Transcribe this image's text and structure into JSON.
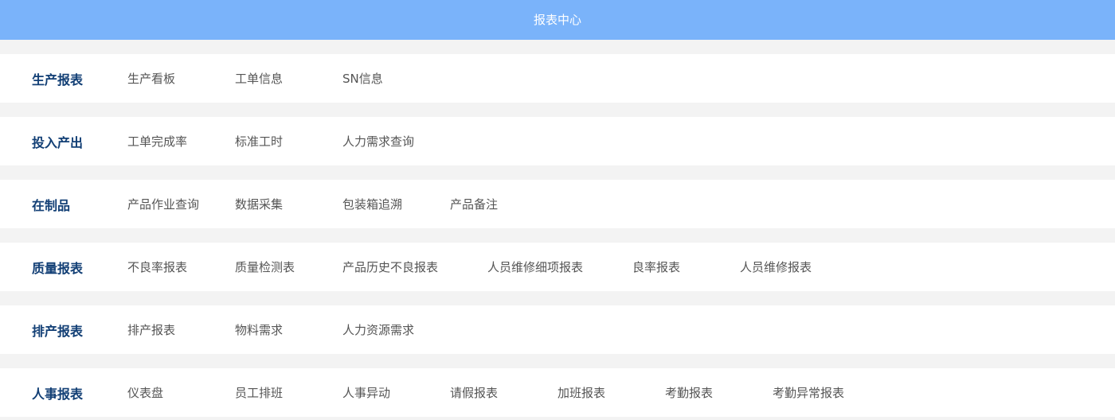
{
  "header": {
    "title": "报表中心"
  },
  "sections": [
    {
      "title": "生产报表",
      "items": [
        "生产看板",
        "工单信息",
        "SN信息"
      ]
    },
    {
      "title": "投入产出",
      "items": [
        "工单完成率",
        "标准工时",
        "人力需求查询"
      ]
    },
    {
      "title": "在制品",
      "items": [
        "产品作业查询",
        "数据采集",
        "包装箱追溯",
        "产品备注"
      ]
    },
    {
      "title": "质量报表",
      "items": [
        "不良率报表",
        "质量检测表",
        "产品历史不良报表",
        "人员维修细项报表",
        "良率报表",
        "人员维修报表"
      ]
    },
    {
      "title": "排产报表",
      "items": [
        "排产报表",
        "物料需求",
        "人力资源需求"
      ]
    },
    {
      "title": "人事报表",
      "items": [
        "仪表盘",
        "员工排班",
        "人事异动",
        "请假报表",
        "加班报表",
        "考勤报表",
        "考勤异常报表"
      ]
    }
  ],
  "colors": {
    "header_bg": "#7ab3fa",
    "section_title": "#123f75",
    "link_text": "#555555",
    "page_bg": "#f3f3f3"
  }
}
